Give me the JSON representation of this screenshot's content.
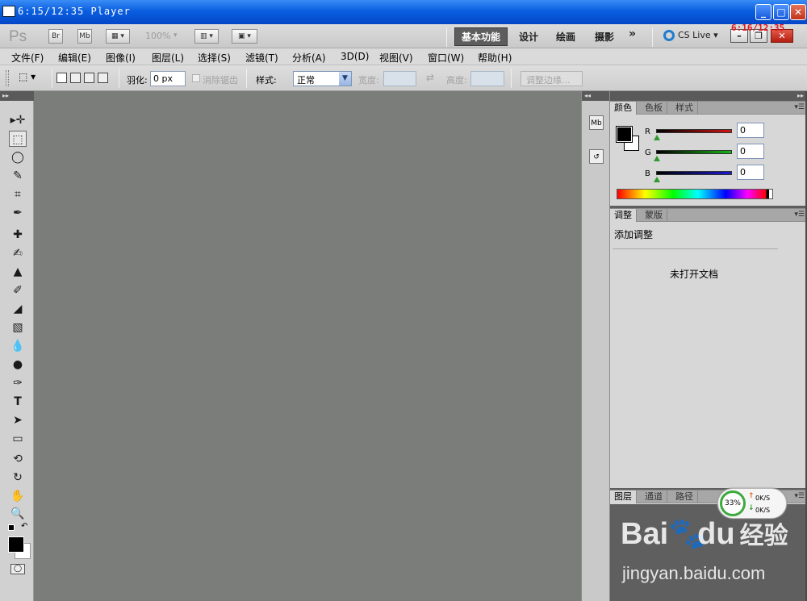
{
  "window": {
    "title": "6:15/12:35 Player",
    "overlay_time": "6:16/12:35"
  },
  "topbar": {
    "logo": "Ps",
    "bridge_label": "Br",
    "minibridge_label": "Mb",
    "zoom": "100%",
    "workspaces": [
      "基本功能",
      "设计",
      "绘画",
      "摄影"
    ],
    "more": "»",
    "cslive": "CS Live"
  },
  "menu": [
    "文件(F)",
    "编辑(E)",
    "图像(I)",
    "图层(L)",
    "选择(S)",
    "滤镜(T)",
    "分析(A)",
    "3D(D)",
    "视图(V)",
    "窗口(W)",
    "帮助(H)"
  ],
  "options": {
    "feather_label": "羽化:",
    "feather_value": "0 px",
    "antialias_label": "消除锯齿",
    "style_label": "样式:",
    "style_value": "正常",
    "width_label": "宽度:",
    "height_label": "高度:",
    "refine_button": "调整边缘..."
  },
  "color_panel": {
    "tabs": [
      "颜色",
      "色板",
      "样式"
    ],
    "channels": [
      {
        "label": "R",
        "value": "0",
        "color": "#d41414"
      },
      {
        "label": "G",
        "value": "0",
        "color": "#16b516"
      },
      {
        "label": "B",
        "value": "0",
        "color": "#1a1ad1"
      }
    ]
  },
  "adjust_panel": {
    "tabs": [
      "调整",
      "蒙版"
    ],
    "title": "添加调整",
    "message": "未打开文档"
  },
  "layers_panel": {
    "tabs": [
      "图层",
      "通道",
      "路径"
    ]
  },
  "net_widget": {
    "percent": "33%",
    "up": "0K/S",
    "down": "0K/S"
  },
  "watermark": {
    "brand": "Bai",
    "brand2": "du",
    "cn": "经验",
    "url": "jingyan.baidu.com"
  }
}
